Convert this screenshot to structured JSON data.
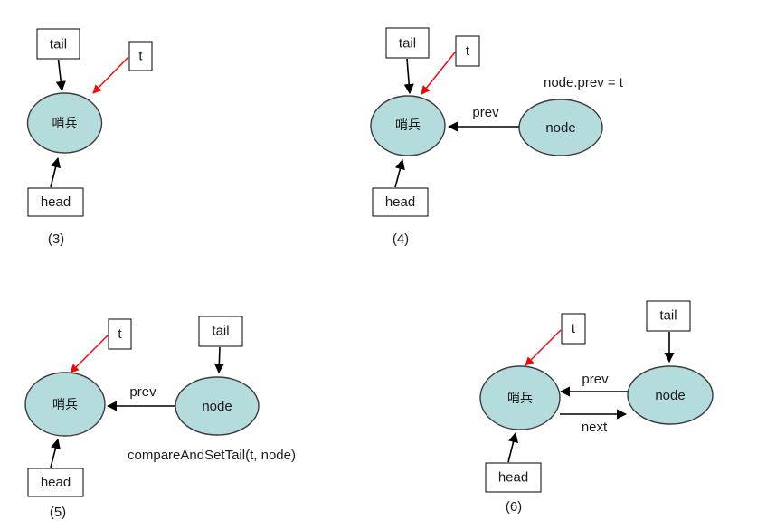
{
  "figure": {
    "background_color": "#ffffff",
    "node_fill_color": "#b5dcdc",
    "node_stroke_color": "#3c3c3c",
    "box_fill_color": "#ffffff",
    "box_stroke_color": "#000000",
    "edge_color": "#000000",
    "highlight_edge_color": "#ff0000",
    "text_color": "#1a1a1a"
  },
  "panels": [
    {
      "id": "panel-3",
      "caption": "(3)",
      "boxes": [
        {
          "name": "tail-box",
          "label": "tail"
        },
        {
          "name": "t-box",
          "label": "t"
        },
        {
          "name": "head-box",
          "label": "head"
        }
      ],
      "ellipses": [
        {
          "name": "sentinel-node",
          "label": "哨兵"
        }
      ],
      "edges": [
        {
          "name": "tail-to-sentinel",
          "label": "",
          "color": "#000000"
        },
        {
          "name": "t-to-sentinel",
          "label": "",
          "color": "#ff0000"
        },
        {
          "name": "head-to-sentinel",
          "label": "",
          "color": "#000000"
        }
      ],
      "notes": []
    },
    {
      "id": "panel-4",
      "caption": "(4)",
      "boxes": [
        {
          "name": "tail-box",
          "label": "tail"
        },
        {
          "name": "t-box",
          "label": "t"
        },
        {
          "name": "head-box",
          "label": "head"
        }
      ],
      "ellipses": [
        {
          "name": "sentinel-node",
          "label": "哨兵"
        },
        {
          "name": "node-node",
          "label": "node"
        }
      ],
      "edges": [
        {
          "name": "tail-to-sentinel",
          "label": "",
          "color": "#000000"
        },
        {
          "name": "t-to-sentinel",
          "label": "",
          "color": "#ff0000"
        },
        {
          "name": "head-to-sentinel",
          "label": "",
          "color": "#000000"
        },
        {
          "name": "node-prev-to-sentinel",
          "label": "prev",
          "color": "#000000"
        }
      ],
      "notes": [
        {
          "name": "operation-note",
          "text": "node.prev = t"
        }
      ]
    },
    {
      "id": "panel-5",
      "caption": "(5)",
      "boxes": [
        {
          "name": "t-box",
          "label": "t"
        },
        {
          "name": "tail-box",
          "label": "tail"
        },
        {
          "name": "head-box",
          "label": "head"
        }
      ],
      "ellipses": [
        {
          "name": "sentinel-node",
          "label": "哨兵"
        },
        {
          "name": "node-node",
          "label": "node"
        }
      ],
      "edges": [
        {
          "name": "t-to-sentinel",
          "label": "",
          "color": "#ff0000"
        },
        {
          "name": "head-to-sentinel",
          "label": "",
          "color": "#000000"
        },
        {
          "name": "tail-to-node",
          "label": "",
          "color": "#000000"
        },
        {
          "name": "node-prev-to-sentinel",
          "label": "prev",
          "color": "#000000"
        }
      ],
      "notes": [
        {
          "name": "operation-note",
          "text": "compareAndSetTail(t, node)"
        }
      ]
    },
    {
      "id": "panel-6",
      "caption": "(6)",
      "boxes": [
        {
          "name": "t-box",
          "label": "t"
        },
        {
          "name": "tail-box",
          "label": "tail"
        },
        {
          "name": "head-box",
          "label": "head"
        }
      ],
      "ellipses": [
        {
          "name": "sentinel-node",
          "label": "哨兵"
        },
        {
          "name": "node-node",
          "label": "node"
        }
      ],
      "edges": [
        {
          "name": "t-to-sentinel",
          "label": "",
          "color": "#ff0000"
        },
        {
          "name": "head-to-sentinel",
          "label": "",
          "color": "#000000"
        },
        {
          "name": "tail-to-node",
          "label": "",
          "color": "#000000"
        },
        {
          "name": "node-prev-to-sentinel",
          "label": "prev",
          "color": "#000000"
        },
        {
          "name": "sentinel-next-to-node",
          "label": "next",
          "color": "#000000"
        }
      ],
      "notes": []
    }
  ]
}
